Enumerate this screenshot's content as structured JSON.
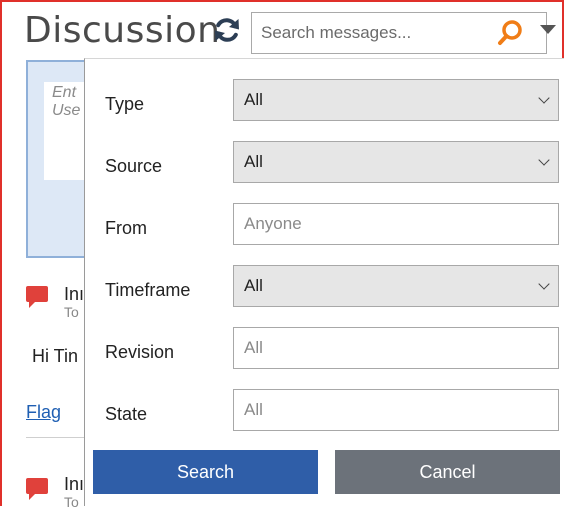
{
  "header": {
    "title": "Discussion",
    "search_placeholder": "Search messages..."
  },
  "icons": {
    "refresh": "refresh-icon",
    "search": "search-icon",
    "dropdown": "chevron-down-icon",
    "message": "message-icon"
  },
  "colors": {
    "frame_border": "#e0302a",
    "accent": "#2f5ea8",
    "cancel": "#6c727a",
    "search_icon": "#f07d17",
    "message_icon": "#e0413b"
  },
  "composer": {
    "placeholder_line1": "Ent",
    "placeholder_line2": "Use"
  },
  "messages": [
    {
      "name": "Inı",
      "sub": "To"
    },
    {
      "name": "Inı",
      "sub": "To"
    }
  ],
  "message_body": "Hi Tin",
  "flag_label": "Flag",
  "filter": {
    "type": {
      "label": "Type",
      "value": "All"
    },
    "source": {
      "label": "Source",
      "value": "All"
    },
    "from": {
      "label": "From",
      "placeholder": "Anyone"
    },
    "timeframe": {
      "label": "Timeframe",
      "value": "All"
    },
    "revision": {
      "label": "Revision",
      "placeholder": "All"
    },
    "state": {
      "label": "State",
      "placeholder": "All"
    },
    "search_label": "Search",
    "cancel_label": "Cancel"
  }
}
